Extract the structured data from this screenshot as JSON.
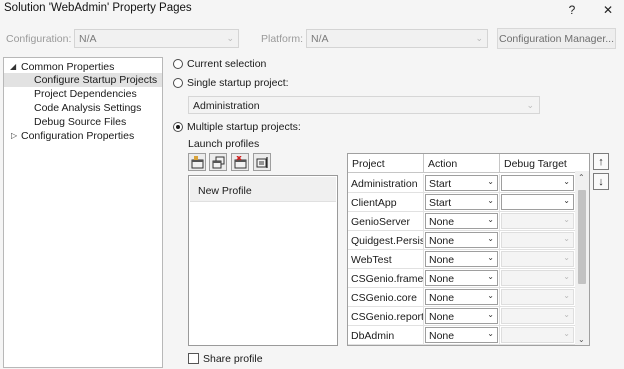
{
  "window": {
    "title": "Solution 'WebAdmin' Property Pages",
    "help_label": "?",
    "close_label": "✕"
  },
  "config_bar": {
    "configuration_label": "Configuration:",
    "configuration_value": "N/A",
    "platform_label": "Platform:",
    "platform_value": "N/A",
    "manager_button": "Configuration Manager..."
  },
  "tree": {
    "items": [
      {
        "label": "Common Properties",
        "expanded": true
      },
      {
        "label": "Configure Startup Projects",
        "selected": true
      },
      {
        "label": "Project Dependencies"
      },
      {
        "label": "Code Analysis Settings"
      },
      {
        "label": "Debug Source Files"
      },
      {
        "label": "Configuration Properties",
        "expanded": false
      }
    ]
  },
  "startup": {
    "current_selection_label": "Current selection",
    "single_label": "Single startup project:",
    "single_value": "Administration",
    "multiple_label": "Multiple startup projects:",
    "selected_option": "multiple",
    "launch_profiles_label": "Launch profiles",
    "profile_icons": [
      "new-profile-icon",
      "copy-profile-icon",
      "delete-profile-icon",
      "rename-profile-icon"
    ],
    "profiles": [
      "New Profile"
    ],
    "share_profile_label": "Share profile",
    "share_profile_checked": false
  },
  "grid": {
    "headers": {
      "project": "Project",
      "action": "Action",
      "debug_target": "Debug Target"
    },
    "rows": [
      {
        "project": "Administration",
        "action": "Start"
      },
      {
        "project": "ClientApp",
        "action": "Start"
      },
      {
        "project": "GenioServer",
        "action": "None"
      },
      {
        "project": "Quidgest.Persistence",
        "action": "None"
      },
      {
        "project": "WebTest",
        "action": "None"
      },
      {
        "project": "CSGenio.framework",
        "action": "None"
      },
      {
        "project": "CSGenio.core",
        "action": "None"
      },
      {
        "project": "CSGenio.reporting",
        "action": "None"
      },
      {
        "project": "DbAdmin",
        "action": "None"
      }
    ],
    "move_up_icon": "arrow-up-icon",
    "move_down_icon": "arrow-down-icon"
  }
}
